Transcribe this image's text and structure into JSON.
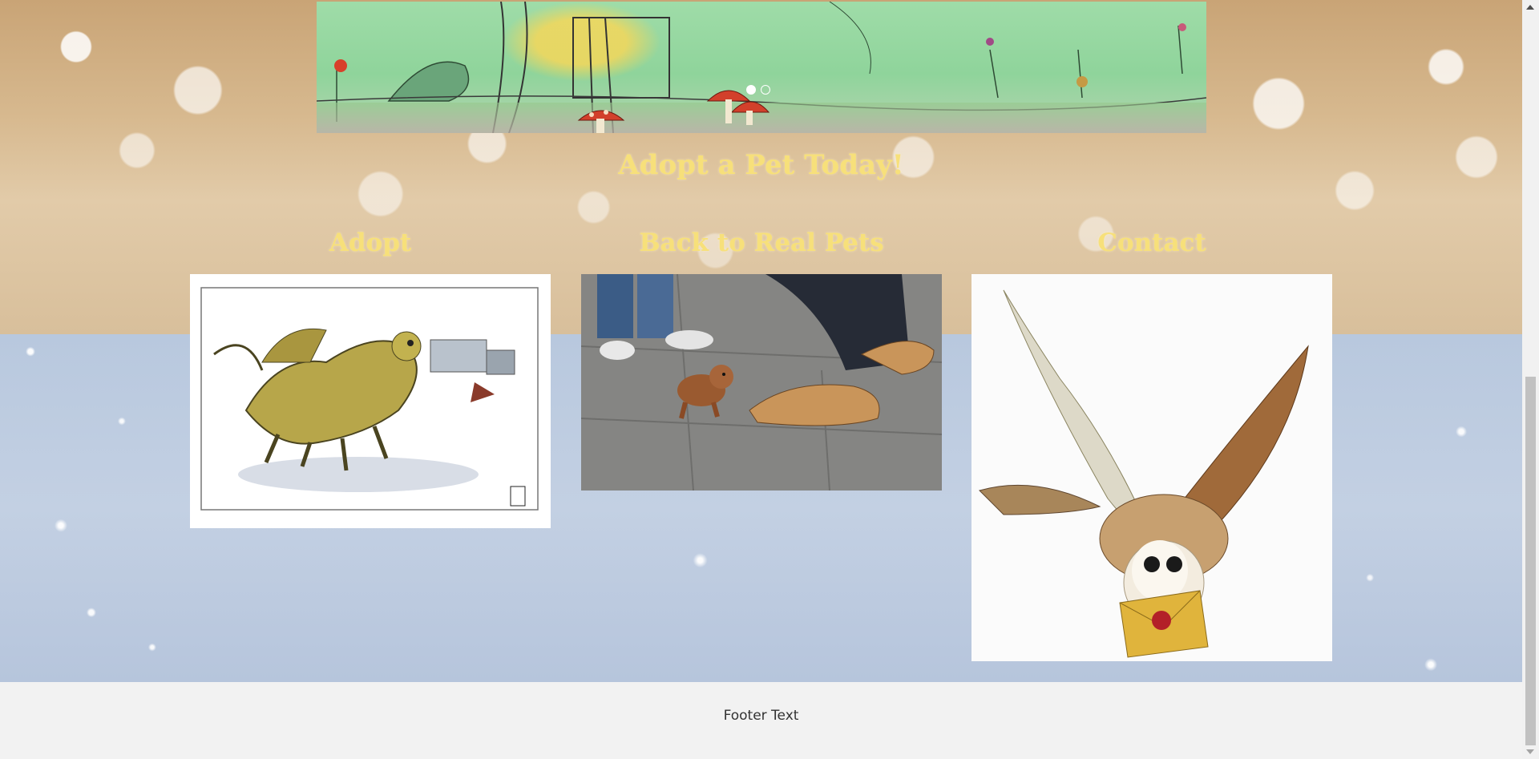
{
  "page_heading": "Adopt a Pet Today!",
  "carousel": {
    "slide_count": 2,
    "active_slide": 1
  },
  "columns": [
    {
      "title": "Adopt",
      "image": "dragon-illustration"
    },
    {
      "title": "Back to Real Pets",
      "image": "puppy-photo"
    },
    {
      "title": "Contact",
      "image": "owl-with-letter"
    }
  ],
  "footer": {
    "text": "Footer Text"
  },
  "colors": {
    "heading": "#f7e07a",
    "footer_bg": "#f2f2f2"
  }
}
